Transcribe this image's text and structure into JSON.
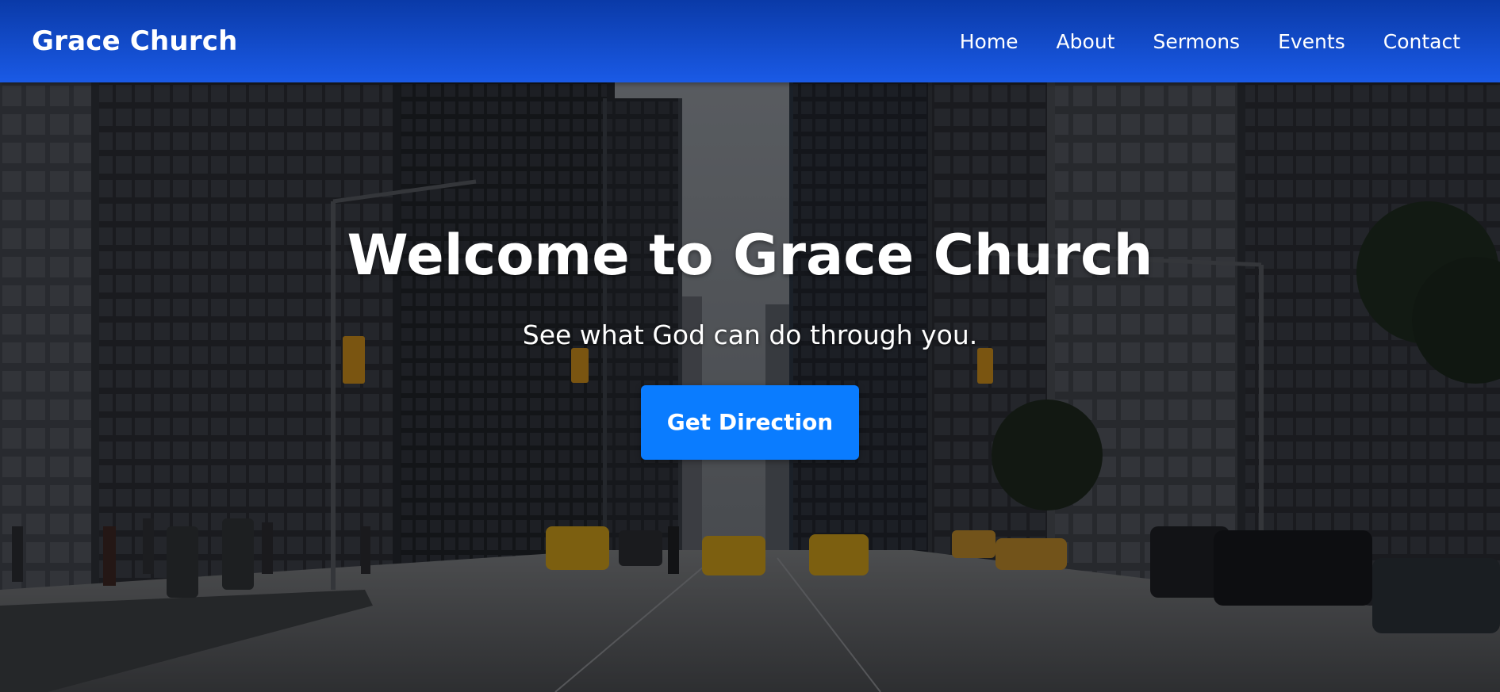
{
  "brand": {
    "name": "Grace Church"
  },
  "nav": {
    "items": [
      {
        "label": "Home"
      },
      {
        "label": "About"
      },
      {
        "label": "Sermons"
      },
      {
        "label": "Events"
      },
      {
        "label": "Contact"
      }
    ]
  },
  "hero": {
    "title": "Welcome to Grace Church",
    "subtitle": "See what God can do through you.",
    "cta_label": "Get Direction"
  },
  "colors": {
    "nav_start": "#0a3aa8",
    "nav_end": "#1a5ae6",
    "cta": "#0a7cff"
  }
}
